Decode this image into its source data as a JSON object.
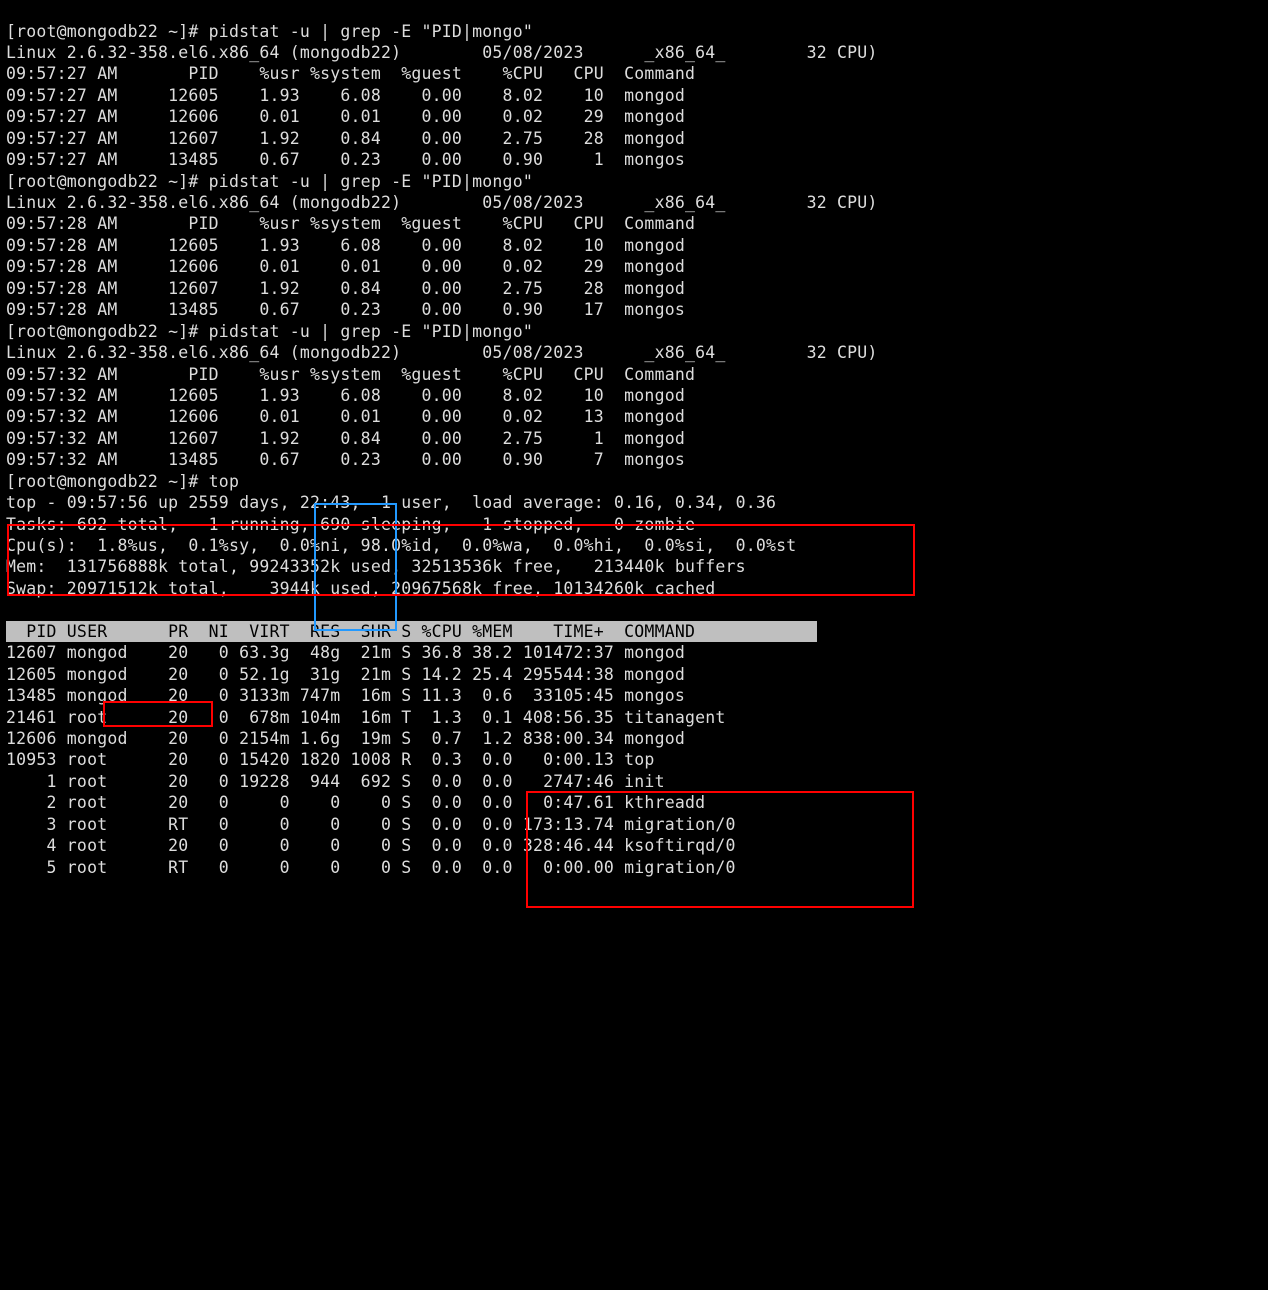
{
  "prompt": "[root@mongodb22 ~]# ",
  "cmd_pidstat": "pidstat -u | grep -E \"PID|mongo\"",
  "cmd_top": "top",
  "sysline": "Linux 2.6.32-358.el6.x86_64 (mongodb22)        05/08/2023      _x86_64_        32 CPU)",
  "pid_header": "09:57:{T} AM      PID    %usr %system  %guest    %CPU   CPU  Command",
  "pidruns": [
    {
      "t": "27",
      "rows": [
        [
          "12605",
          "1.93",
          "6.08",
          "0.00",
          "8.02",
          "10",
          "mongod"
        ],
        [
          "12606",
          "0.01",
          "0.01",
          "0.00",
          "0.02",
          "29",
          "mongod"
        ],
        [
          "12607",
          "1.92",
          "0.84",
          "0.00",
          "2.75",
          "28",
          "mongod"
        ],
        [
          "13485",
          "0.67",
          "0.23",
          "0.00",
          "0.90",
          " 1",
          "mongos"
        ]
      ]
    },
    {
      "t": "28",
      "rows": [
        [
          "12605",
          "1.93",
          "6.08",
          "0.00",
          "8.02",
          "10",
          "mongod"
        ],
        [
          "12606",
          "0.01",
          "0.01",
          "0.00",
          "0.02",
          "29",
          "mongod"
        ],
        [
          "12607",
          "1.92",
          "0.84",
          "0.00",
          "2.75",
          "28",
          "mongod"
        ],
        [
          "13485",
          "0.67",
          "0.23",
          "0.00",
          "0.90",
          "17",
          "mongos"
        ]
      ]
    },
    {
      "t": "32",
      "rows": [
        [
          "12605",
          "1.93",
          "6.08",
          "0.00",
          "8.02",
          "10",
          "mongod"
        ],
        [
          "12606",
          "0.01",
          "0.01",
          "0.00",
          "0.02",
          "13",
          "mongod"
        ],
        [
          "12607",
          "1.92",
          "0.84",
          "0.00",
          "2.75",
          " 1",
          "mongod"
        ],
        [
          "13485",
          "0.67",
          "0.23",
          "0.00",
          "0.90",
          " 7",
          "mongos"
        ]
      ]
    }
  ],
  "top": {
    "l1": "top - 09:57:56 up 2559 days, 22:43,  1 user,  load average: 0.16, 0.34, 0.36",
    "l2": "Tasks: 692 total,   1 running, 690 sleeping,   1 stopped,   0 zombie",
    "l3": "Cpu(s):  1.8%us,  0.1%sy,  0.0%ni, 98.0%id,  0.0%wa,  0.0%hi,  0.0%si,  0.0%st",
    "l4": "Mem:  131756888k total, 99243352k used, 32513536k free,   213440k buffers",
    "l5": "Swap: 20971512k total,    3944k used, 20967568k free, 10134260k cached",
    "header": "  PID USER      PR  NI  VIRT  RES  SHR S %CPU %MEM    TIME+  COMMAND",
    "rows": [
      [
        "12607",
        "mongod",
        "20",
        "0",
        "63.3g",
        " 48g",
        " 21m",
        "S",
        "36.8",
        "38.2",
        "101472:37",
        "mongod"
      ],
      [
        "12605",
        "mongod",
        "20",
        "0",
        "52.1g",
        " 31g",
        " 21m",
        "S",
        "14.2",
        "25.4",
        "295544:38",
        "mongod"
      ],
      [
        "13485",
        "mongod",
        "20",
        "0",
        "3133m",
        "747m",
        " 16m",
        "S",
        "11.3",
        " 0.6",
        " 33105:45",
        "mongos"
      ],
      [
        "21461",
        "root  ",
        "20",
        "0",
        " 678m",
        "104m",
        " 16m",
        "T",
        " 1.3",
        " 0.1",
        "408:56.35",
        "titanagent"
      ],
      [
        "12606",
        "mongod",
        "20",
        "0",
        "2154m",
        "1.6g",
        " 19m",
        "S",
        " 0.7",
        " 1.2",
        "838:00.34",
        "mongod"
      ],
      [
        "10953",
        "root  ",
        "20",
        "0",
        "15420",
        "1820",
        "1008",
        "R",
        " 0.3",
        " 0.0",
        "  0:00.13",
        "top"
      ],
      [
        "    1",
        "root  ",
        "20",
        "0",
        "19228",
        " 944",
        " 692",
        "S",
        " 0.0",
        " 0.0",
        "  2747:46",
        "init"
      ],
      [
        "    2",
        "root  ",
        "20",
        "0",
        "    0",
        "   0",
        "   0",
        "S",
        " 0.0",
        " 0.0",
        "  0:47.61",
        "kthreadd"
      ],
      [
        "    3",
        "root  ",
        "RT",
        "0",
        "    0",
        "   0",
        "   0",
        "S",
        " 0.0",
        " 0.0",
        "173:13.74",
        "migration/0"
      ],
      [
        "    4",
        "root  ",
        "20",
        "0",
        "    0",
        "   0",
        "   0",
        "S",
        " 0.0",
        " 0.0",
        "328:46.44",
        "ksoftirqd/0"
      ],
      [
        "    5",
        "root  ",
        "RT",
        "0",
        "    0",
        "   0",
        "   0",
        "S",
        " 0.0",
        " 0.0",
        "  0:00.00",
        "migration/0"
      ]
    ]
  }
}
